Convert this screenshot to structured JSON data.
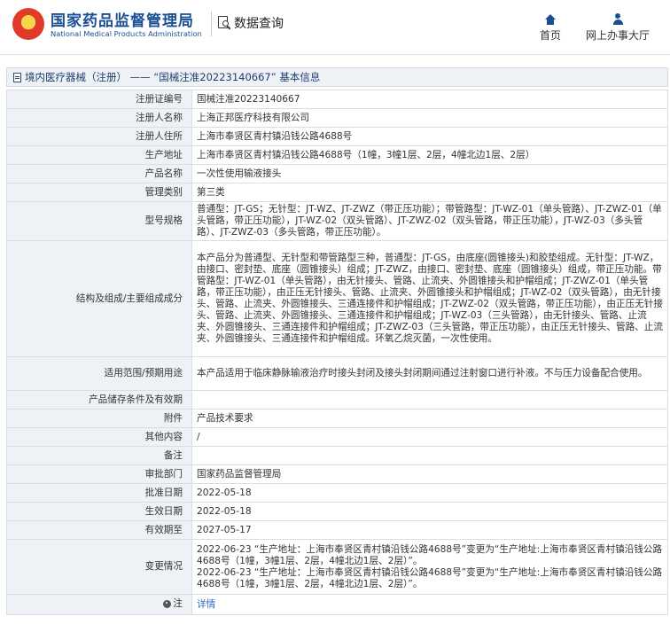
{
  "header": {
    "brand_cn": "国家药品监督管理局",
    "brand_en": "National Medical Products Administration",
    "query_label": "数据查询",
    "nav": {
      "home_label": "首页",
      "online_label": "网上办事大厅"
    }
  },
  "breadcrumb": {
    "text": "境内医疗器械（注册） —— “国械注准20223140667” 基本信息"
  },
  "fields": {
    "reg_no": {
      "label": "注册证编号",
      "value": "国械注准20223140667"
    },
    "registrant": {
      "label": "注册人名称",
      "value": "上海正邦医疗科技有限公司"
    },
    "registrant_address": {
      "label": "注册人住所",
      "value": "上海市奉贤区青村镇沿钱公路4688号"
    },
    "production_address": {
      "label": "生产地址",
      "value": "上海市奉贤区青村镇沿钱公路4688号（1幢，3幢1层、2层，4幢北边1层、2层）"
    },
    "product_name": {
      "label": "产品名称",
      "value": "一次性使用输液接头"
    },
    "mgmt_class": {
      "label": "管理类别",
      "value": "第三类"
    },
    "model_spec": {
      "label": "型号规格",
      "value": "普通型：JT-GS；无针型：JT-WZ、JT-ZWZ（带正压功能）；带管路型：JT-WZ-01（单头管路）、JT-ZWZ-01（单头管路，带正压功能），JT-WZ-02（双头管路）、JT-ZWZ-02（双头管路，带正压功能），JT-WZ-03（多头管路）、JT-ZWZ-03（多头管路，带正压功能）。"
    },
    "structure": {
      "label": "结构及组成/主要组成成分",
      "value": "本产品分为普通型、无针型和带管路型三种，普通型：JT-GS，由底座(圆锥接头)和胶垫组成。无针型：JT-WZ，由接口、密封垫、底座（圆锥接头）组成；JT-ZWZ，由接口、密封垫、底座（圆锥接头）组成，带正压功能。带管路型：JT-WZ-01（单头管路），由无针接头、管路、止流夹、外圆锥接头和护帽组成；JT-ZWZ-01（单头管路，带正压功能），由正压无针接头、管路、止流夹、外圆锥接头和护帽组成；JT-WZ-02（双头管路），由无针接头、管路、止流夹、外圆锥接头、三通连接件和护帽组成；JT-ZWZ-02（双头管路，带正压功能），由正压无针接头、管路、止流夹、外圆锥接头、三通连接件和护帽组成；JT-WZ-03（三头管路），由无针接头、管路、止流夹、外圆锥接头、三通连接件和护帽组成；JT-ZWZ-03（三头管路，带正压功能），由正压无针接头、管路、止流夹、外圆锥接头、三通连接件和护帽组成。环氧乙烷灭菌，一次性使用。"
    },
    "scope": {
      "label": "适用范围/预期用途",
      "value": "本产品适用于临床静脉输液治疗时接头封闭及接头封闭期间通过注射窗口进行补液。不与压力设备配合使用。"
    },
    "storage": {
      "label": "产品储存条件及有效期",
      "value": ""
    },
    "attachment": {
      "label": "附件",
      "value": "产品技术要求"
    },
    "other": {
      "label": "其他内容",
      "value": "/"
    },
    "remark": {
      "label": "备注",
      "value": ""
    },
    "approval_dept": {
      "label": "审批部门",
      "value": "国家药品监督管理局"
    },
    "approval_date": {
      "label": "批准日期",
      "value": "2022-05-18"
    },
    "effective_date": {
      "label": "生效日期",
      "value": "2022-05-18"
    },
    "expiry_date": {
      "label": "有效期至",
      "value": "2027-05-17"
    },
    "changes": {
      "label": "变更情况",
      "items": [
        "2022-06-23 “生产地址：上海市奉贤区青村镇沿钱公路4688号”变更为“生产地址:上海市奉贤区青村镇沿钱公路4688号（1幢，3幢1层、2层，4幢北边1层、2层）”。",
        "2022-06-23 “生产地址：上海市奉贤区青村镇沿钱公路4688号”变更为“生产地址:上海市奉贤区青村镇沿钱公路4688号（1幢，3幢1层、2层，4幢北边1层、2层）”。"
      ]
    },
    "note": {
      "label": "注",
      "link": "详情"
    }
  }
}
